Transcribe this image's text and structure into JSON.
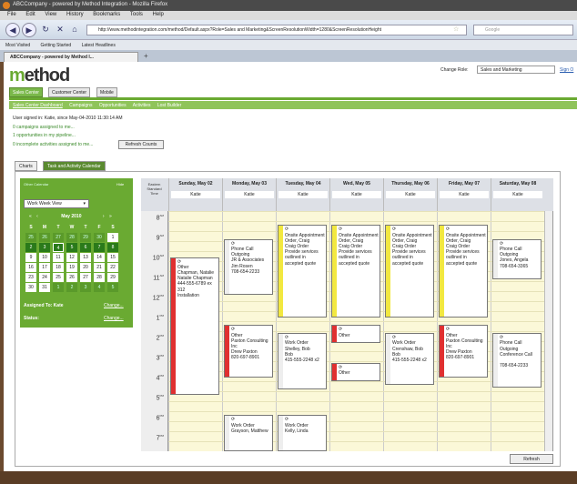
{
  "browser": {
    "window_title": "ABCCompany - powered by Method Integration - Mozilla Firefox",
    "menu": [
      "File",
      "Edit",
      "View",
      "History",
      "Bookmarks",
      "Tools",
      "Help"
    ],
    "url": "http://www.methodintegration.com/method/Default.aspx?Role=Sales and Marketing&ScreenResolutionWidth=1280&ScreenResolutionHeight",
    "search_placeholder": "Google",
    "bookmarks": [
      "Most Visited",
      "Getting Started",
      "Latest Headlines"
    ],
    "tab_title": "ABCCompany - powered by Method I..."
  },
  "app": {
    "logo_prefix": "m",
    "logo_rest": "ethod",
    "change_role_label": "Change Role:",
    "role_value": "Sales and Marketing",
    "sign_out": "Sign O",
    "main_tabs": [
      "Sales Center",
      "Customer Center",
      "Mobile"
    ],
    "sub_nav": [
      "Sales Center Dashboard",
      "Campaigns",
      "Opportunities",
      "Activities",
      "Lost Builder"
    ],
    "signed_in": "User signed in: Katie, since May-04-2010 11:30:14 AM",
    "pipeline": [
      "0 campaigns assigned to me...",
      "1 opportunities in my pipeline...",
      "0 incomplete activities assigned to me..."
    ],
    "refresh_counts": "Refresh Counts",
    "view_tabs": [
      "Charts",
      "Task and Activity Calendar"
    ]
  },
  "sidebar": {
    "other_view": "Other Calendar",
    "hide": "Hide",
    "view_select": "Work Week View",
    "month_label": "May 2010",
    "day_headers": [
      "S",
      "M",
      "T",
      "W",
      "T",
      "F",
      "S"
    ],
    "weeks": [
      [
        "25",
        "26",
        "27",
        "28",
        "29",
        "30",
        "1"
      ],
      [
        "2",
        "3",
        "4",
        "5",
        "6",
        "7",
        "8"
      ],
      [
        "9",
        "10",
        "11",
        "12",
        "13",
        "14",
        "15"
      ],
      [
        "16",
        "17",
        "18",
        "19",
        "20",
        "21",
        "22"
      ],
      [
        "23",
        "24",
        "25",
        "26",
        "27",
        "28",
        "29"
      ],
      [
        "30",
        "31",
        "1",
        "2",
        "3",
        "4",
        "5"
      ]
    ],
    "assigned_label": "Assigned To: Kate",
    "status_label": "Status:",
    "change": "Change..."
  },
  "calendar": {
    "tz_label": "Eastern Standard Time",
    "user": "Katie",
    "days": [
      "Sunday, May 02",
      "Monday, May 03",
      "Tuesday, May 04",
      "Wed, May 05",
      "Thursday, May 06",
      "Friday, May 07",
      "Saturday, May 08"
    ],
    "hours": [
      "8",
      "9",
      "10",
      "11",
      "12",
      "1",
      "2",
      "3",
      "4",
      "5",
      "6",
      "7"
    ],
    "hour_suffix": [
      "AM",
      "AM",
      "AM",
      "AM",
      "PM",
      "PM",
      "PM",
      "PM",
      "PM",
      "PM",
      "PM",
      "PM"
    ],
    "appointments": [
      {
        "text": "Other\nChapman, Natalie\nNatalie Chapman\n444-555-6789 ex 312\nInstallation"
      },
      {
        "text": "Phone Call\nOutgoing\nJR & Associates\nJim Rosen\n708-654-2233"
      },
      {
        "text": "Onsite Appointment\nOrder, Craig\nCraig Order\nProvide services outlined in accepted quote"
      },
      {
        "text": "Onsite Appointment\nOrder, Craig\nCraig Order\nProvide services outlined in accepted quote"
      },
      {
        "text": "Onsite Appointment\nOrder, Craig\nCraig Order\nProvide services outlined in accepted quote"
      },
      {
        "text": "Onsite Appointment\nOrder, Craig\nCraig Order\nProvide services outlined in accepted quote"
      },
      {
        "text": "Phone Call\nOutgoing\nJones, Angela\n708-654-3365"
      },
      {
        "text": "Other\nPaxton Consulting Inc\nDrew Paxton\n820-697-8901"
      },
      {
        "text": "Work Order\nShelley, Bob\nBob\n415-555-2248 x2"
      },
      {
        "text": "Other"
      },
      {
        "text": "Work Order\nCrenshaw, Bob\nBob\n415-555-2248 x2"
      },
      {
        "text": "Other\nPaxton Consulting Inc\nDrew Paxton\n820-697-8901"
      },
      {
        "text": "Phone Call\nOutgoing\nConference Call\n\n708-654-2233"
      },
      {
        "text": "Other"
      },
      {
        "text": "Work Order\nGrayson, Matthew"
      },
      {
        "text": "Work Order\nKelly, Linda"
      }
    ],
    "refresh": "Refresh"
  }
}
